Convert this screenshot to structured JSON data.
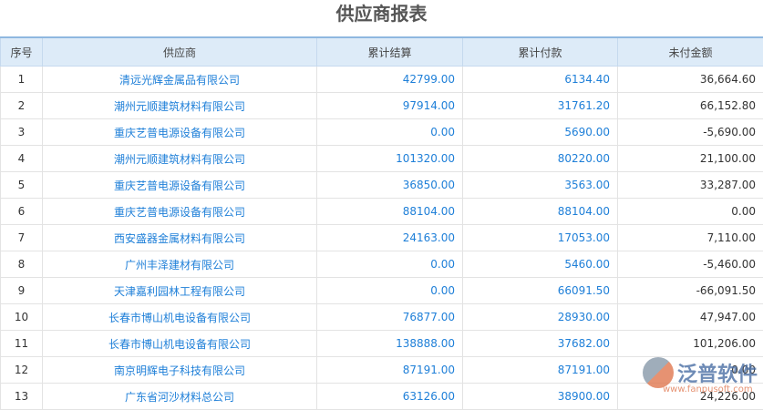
{
  "title": "供应商报表",
  "columns": [
    "序号",
    "供应商",
    "累计结算",
    "累计付款",
    "未付金额"
  ],
  "rows": [
    [
      "1",
      "清远光辉金属品有限公司",
      "42799.00",
      "6134.40",
      "36,664.60"
    ],
    [
      "2",
      "潮州元顺建筑材料有限公司",
      "97914.00",
      "31761.20",
      "66,152.80"
    ],
    [
      "3",
      "重庆艺普电源设备有限公司",
      "0.00",
      "5690.00",
      "-5,690.00"
    ],
    [
      "4",
      "潮州元顺建筑材料有限公司",
      "101320.00",
      "80220.00",
      "21,100.00"
    ],
    [
      "5",
      "重庆艺普电源设备有限公司",
      "36850.00",
      "3563.00",
      "33,287.00"
    ],
    [
      "6",
      "重庆艺普电源设备有限公司",
      "88104.00",
      "88104.00",
      "0.00"
    ],
    [
      "7",
      "西安盛器金属材料有限公司",
      "24163.00",
      "17053.00",
      "7,110.00"
    ],
    [
      "8",
      "广州丰泽建材有限公司",
      "0.00",
      "5460.00",
      "-5,460.00"
    ],
    [
      "9",
      "天津嘉利园林工程有限公司",
      "0.00",
      "66091.50",
      "-66,091.50"
    ],
    [
      "10",
      "长春市博山机电设备有限公司",
      "76877.00",
      "28930.00",
      "47,947.00"
    ],
    [
      "11",
      "长春市博山机电设备有限公司",
      "138888.00",
      "37682.00",
      "101,206.00"
    ],
    [
      "12",
      "南京明辉电子科技有限公司",
      "87191.00",
      "87191.00",
      "0.00"
    ],
    [
      "13",
      "广东省河沙材料总公司",
      "63126.00",
      "38900.00",
      "24,226.00"
    ]
  ],
  "watermark": {
    "text": "泛普软件",
    "url": "www.fanpusoft.com"
  }
}
